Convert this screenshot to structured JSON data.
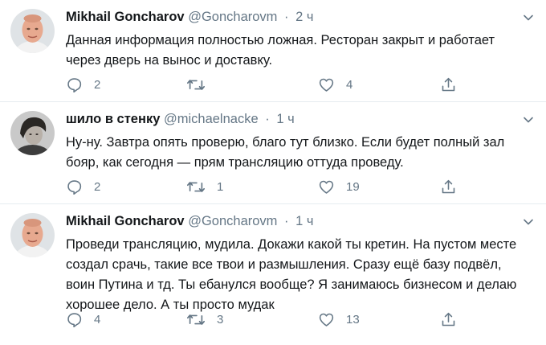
{
  "tweets": [
    {
      "name": "Mikhail Goncharov",
      "handle": "@Goncharovm",
      "separator": "·",
      "time": "2 ч",
      "lines": [
        "Данная информация полностью ложная. Ресторан закрыт и работает",
        "через дверь на вынос и доставку."
      ],
      "replies": "2",
      "retweets": "",
      "likes": "4"
    },
    {
      "name": "шило в стенку",
      "handle": "@michaelnacke",
      "separator": "·",
      "time": "1 ч",
      "lines": [
        "Ну-ну. Завтра опять проверю, благо тут близко. Если будет полный зал",
        "бояр, как сегодня — прям трансляцию оттуда проведу."
      ],
      "replies": "2",
      "retweets": "1",
      "likes": "19"
    },
    {
      "name": "Mikhail Goncharov",
      "handle": "@Goncharovm",
      "separator": "·",
      "time": "1 ч",
      "lines": [
        "Проведи трансляцию, мудила. Докажи какой ты кретин. На пустом месте",
        "создал срачь, такие все твои и размышления. Сразу ещё базу подвёл,",
        "воин Путина и тд. Ты ебанулся вообще? Я занимаюсь бизнесом и делаю",
        "хорошее дело. А ты просто мудак"
      ],
      "replies": "4",
      "retweets": "3",
      "likes": "13"
    }
  ],
  "icons": {
    "reply": "reply-icon",
    "retweet": "retweet-icon",
    "like": "heart-icon",
    "share": "share-icon",
    "menu": "chevron-down-icon"
  },
  "colors": {
    "text": "#14171a",
    "muted": "#657786",
    "divider": "#e6ecf0"
  }
}
